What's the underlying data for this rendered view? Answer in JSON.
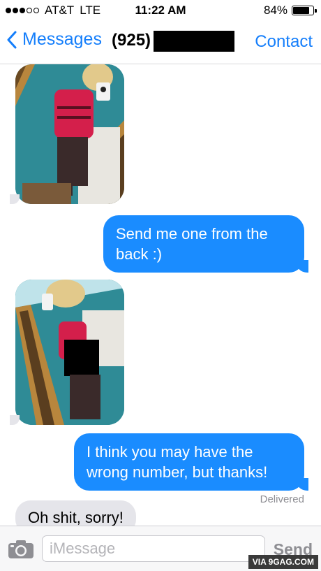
{
  "status_bar": {
    "signal_dots_filled": 3,
    "signal_dots_total": 5,
    "carrier": "AT&T",
    "network": "LTE",
    "time": "11:22 AM",
    "battery_percent": "84%",
    "battery_level": 0.84
  },
  "nav": {
    "back_label": "Messages",
    "title": "(925)",
    "contact_label": "Contact",
    "accent_color": "#147efb"
  },
  "messages": [
    {
      "type": "image",
      "direction": "incoming",
      "content": "photo"
    },
    {
      "type": "text",
      "direction": "outgoing",
      "text": "Send me one from the back :)"
    },
    {
      "type": "image",
      "direction": "incoming",
      "content": "photo"
    },
    {
      "type": "text",
      "direction": "outgoing",
      "text": "I think you may have the wrong number, but thanks!"
    },
    {
      "type": "status",
      "text": "Delivered"
    },
    {
      "type": "text",
      "direction": "incoming",
      "text": "Oh shit, sorry!"
    }
  ],
  "input": {
    "placeholder": "iMessage",
    "value": "",
    "send_label": "Send",
    "camera_icon": "camera-icon"
  },
  "watermark": "VIA 9GAG.COM",
  "colors": {
    "outgoing_bubble": "#1a8cff",
    "incoming_bubble": "#e5e5ea"
  }
}
